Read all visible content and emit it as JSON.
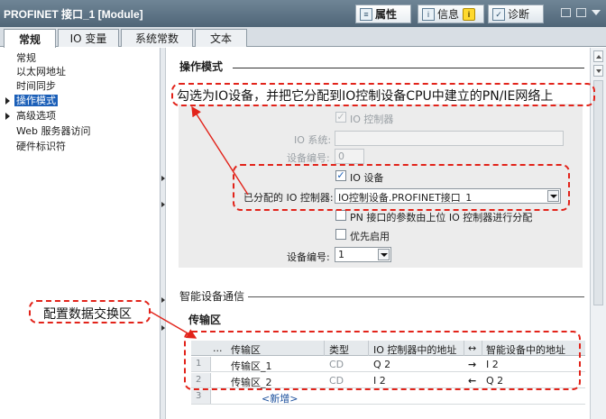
{
  "window": {
    "title": "PROFINET 接口_1 [Module]",
    "panel_tabs": [
      {
        "label": "属性",
        "icon": "properties-icon"
      },
      {
        "label": "信息",
        "icon": "info-icon"
      },
      {
        "label": "诊断",
        "icon": "diagnostics-icon"
      }
    ]
  },
  "tabs": [
    "常规",
    "IO 变量",
    "系统常数",
    "文本"
  ],
  "nav": {
    "items": [
      "常规",
      "以太网地址",
      "时间同步",
      "操作模式",
      "高级选项",
      "Web 服务器访问",
      "硬件标识符"
    ],
    "selected": "操作模式"
  },
  "operating_mode": {
    "heading": "操作模式",
    "io_controller_label": "IO 控制器",
    "io_system_label": "IO 系统:",
    "device_number_label": "设备编号:",
    "device_number_value": "0",
    "io_device_label": "IO 设备",
    "assigned_controller_label": "已分配的 IO 控制器:",
    "assigned_controller_value": "IO控制设备.PROFINET接口_1",
    "pn_params_label": "PN 接口的参数由上位 IO 控制器进行分配",
    "priority_start_label": "优先启用",
    "device_number2_label": "设备编号:",
    "device_number2_value": "1"
  },
  "idevice": {
    "heading": "智能设备通信",
    "transfer_heading": "传输区",
    "columns": [
      "...",
      "传输区",
      "类型",
      "IO 控制器中的地址",
      "↔",
      "智能设备中的地址"
    ],
    "rows": [
      {
        "num": "1",
        "name": "传输区_1",
        "type": "CD",
        "ctrl_addr": "Q 2",
        "dir": "→",
        "dev_addr": "I 2"
      },
      {
        "num": "2",
        "name": "传输区_2",
        "type": "CD",
        "ctrl_addr": "I 2",
        "dir": "←",
        "dev_addr": "Q 2"
      },
      {
        "num": "3",
        "name": "<新增>",
        "type": "",
        "ctrl_addr": "",
        "dir": "",
        "dev_addr": ""
      }
    ]
  },
  "annotations": {
    "top": "勾选为IO设备，并把它分配到IO控制设备CPU中建立的PN/IE网络上",
    "left": "配置数据交换区",
    "color": "#e2231a"
  }
}
